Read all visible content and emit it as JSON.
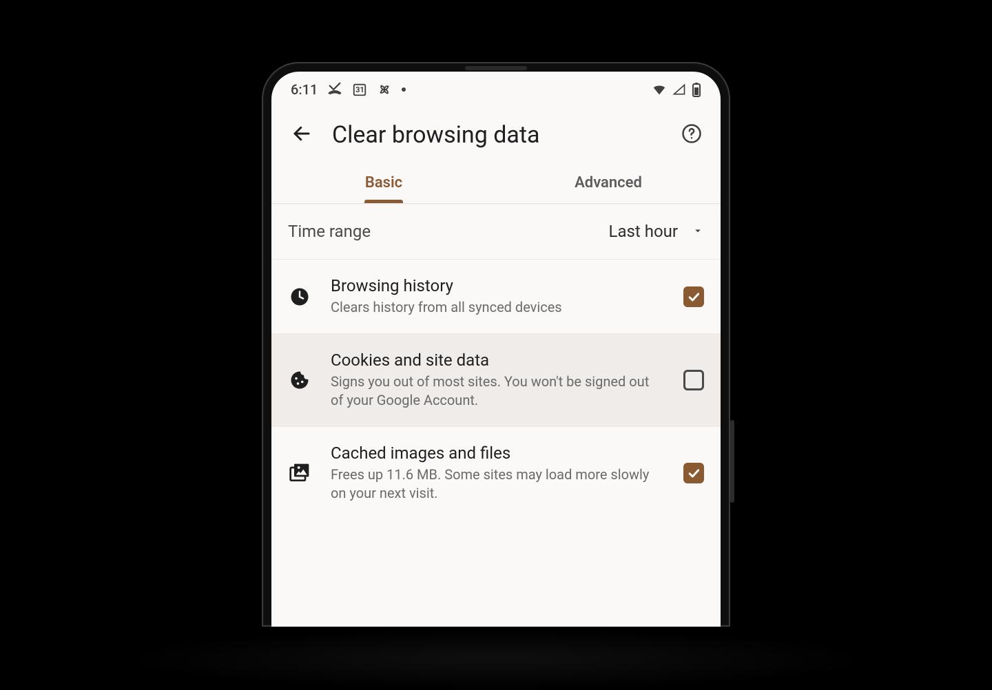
{
  "status": {
    "time": "6:11",
    "calendar_day": "31"
  },
  "appbar": {
    "title": "Clear browsing data"
  },
  "tabs": {
    "basic": "Basic",
    "advanced": "Advanced",
    "active": "basic"
  },
  "timerange": {
    "label": "Time range",
    "value": "Last hour"
  },
  "items": [
    {
      "title": "Browsing history",
      "subtitle": "Clears history from all synced devices",
      "checked": true,
      "icon": "clock"
    },
    {
      "title": "Cookies and site data",
      "subtitle": "Signs you out of most sites. You won't be signed out of your Google Account.",
      "checked": false,
      "icon": "cookie"
    },
    {
      "title": "Cached images and files",
      "subtitle": "Frees up 11.6 MB. Some sites may load more slowly on your next visit.",
      "checked": true,
      "icon": "images"
    }
  ]
}
